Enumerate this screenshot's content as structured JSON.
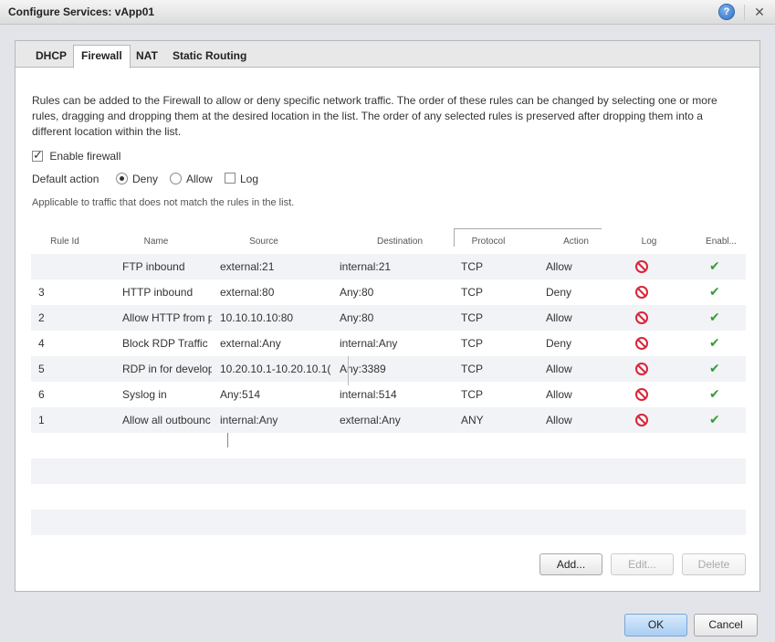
{
  "window": {
    "title": "Configure Services: vApp01",
    "help_icon": "?",
    "close_icon": "✕"
  },
  "tabs": [
    {
      "label": "DHCP"
    },
    {
      "label": "Firewall",
      "active": true
    },
    {
      "label": "NAT"
    },
    {
      "label": "Static Routing"
    }
  ],
  "description": "Rules can be added to the Firewall to allow or deny specific network traffic. The order of these rules can be changed by selecting one or more rules, dragging and dropping them at the desired location in the list. The order of any selected rules is preserved after dropping them into a different location within the list.",
  "enable_firewall": {
    "label": "Enable firewall",
    "checked": true
  },
  "default_action": {
    "label": "Default action",
    "options": [
      {
        "label": "Deny",
        "selected": true
      },
      {
        "label": "Allow",
        "selected": false
      }
    ],
    "log": {
      "label": "Log",
      "checked": false
    }
  },
  "note": "Applicable to traffic that does not match the rules in the list.",
  "table": {
    "columns": [
      "Rule Id",
      "Name",
      "Source",
      "Destination",
      "Protocol",
      "Action",
      "Log",
      "Enabl..."
    ],
    "rows": [
      {
        "id": "",
        "name": "FTP inbound",
        "source": "external:21",
        "destination": "internal:21",
        "protocol": "TCP",
        "action": "Allow",
        "log_icon": "disabled-icon",
        "enabled_icon": "check-icon"
      },
      {
        "id": "3",
        "name": "HTTP inbound",
        "source": "external:80",
        "destination": "Any:80",
        "protocol": "TCP",
        "action": "Deny",
        "log_icon": "disabled-icon",
        "enabled_icon": "check-icon"
      },
      {
        "id": "2",
        "name": "Allow HTTP from p",
        "source": "10.10.10.10:80",
        "destination": "Any:80",
        "protocol": "TCP",
        "action": "Allow",
        "log_icon": "disabled-icon",
        "enabled_icon": "check-icon"
      },
      {
        "id": "4",
        "name": "Block RDP Traffic",
        "source": "external:Any",
        "destination": "internal:Any",
        "protocol": "TCP",
        "action": "Deny",
        "log_icon": "disabled-icon",
        "enabled_icon": "check-icon"
      },
      {
        "id": "5",
        "name": "RDP in for develop",
        "source": "10.20.10.1-10.20.10.1(",
        "destination": "Any:3389",
        "protocol": "TCP",
        "action": "Allow",
        "log_icon": "disabled-icon",
        "enabled_icon": "check-icon"
      },
      {
        "id": "6",
        "name": "Syslog in",
        "source": "Any:514",
        "destination": "internal:514",
        "protocol": "TCP",
        "action": "Allow",
        "log_icon": "disabled-icon",
        "enabled_icon": "check-icon"
      },
      {
        "id": "1",
        "name": "Allow all outbounc",
        "source": "internal:Any",
        "destination": "external:Any",
        "protocol": "ANY",
        "action": "Allow",
        "log_icon": "disabled-icon",
        "enabled_icon": "check-icon"
      }
    ]
  },
  "buttons": {
    "add": "Add...",
    "edit": "Edit...",
    "delete": "Delete",
    "ok": "OK",
    "cancel": "Cancel"
  },
  "colors": {
    "deny_icon": "#d8263a",
    "enabled_check": "#3a9a3a",
    "primary_button": "#a9cdf3"
  }
}
